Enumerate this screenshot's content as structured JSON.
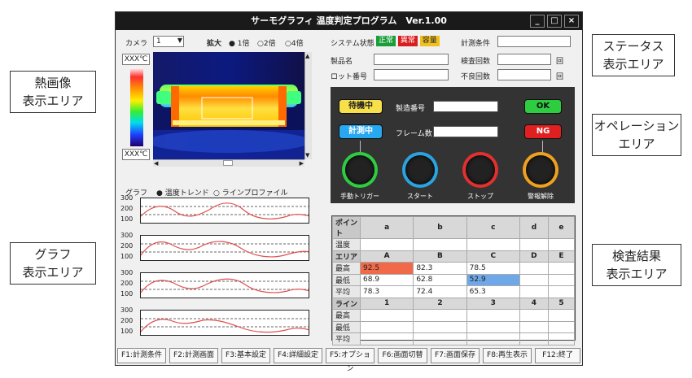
{
  "callouts": {
    "status": "ステータス\n表示エリア",
    "thermal": "熱画像\n表示エリア",
    "operation": "オペレーション\nエリア",
    "graph": "グラフ\n表示エリア",
    "results": "検査結果\n表示エリア"
  },
  "window": {
    "title": "サーモグラフィ 温度判定プログラム　Ver.1.00",
    "minimize": "_",
    "maximize": "□",
    "close": "×"
  },
  "camera": {
    "label": "カメラ",
    "value": "1",
    "zoom_label": "拡大",
    "zoom_options": [
      "1倍",
      "2倍",
      "4倍"
    ],
    "zoom_selected": 0
  },
  "scale": {
    "top": "XXX℃",
    "bottom": "XXX℃"
  },
  "status": {
    "system_label": "システム状態",
    "normal": "正常",
    "abnormal": "異常",
    "capacity": "容量",
    "colors": {
      "normal": "#1a9e3a",
      "abnormal": "#d81e1e",
      "capacity": "#f0c020"
    },
    "product_label": "製品名",
    "lot_label": "ロット番号",
    "condition_label": "計測条件",
    "inspect_count_label": "検査回数",
    "defect_count_label": "不良回数",
    "unit": "回"
  },
  "graph": {
    "label": "グラフ",
    "mode_trend": "温度トレンド",
    "mode_profile": "ラインプロファイル",
    "ticks": [
      "300",
      "200",
      "100"
    ]
  },
  "operation": {
    "standby": "待機中",
    "measuring": "計測中",
    "serial_label": "製造番号",
    "frames_label": "フレーム数",
    "ok": "OK",
    "ng": "NG",
    "knobs": [
      {
        "label": "手動トリガー",
        "color": "#2ecc40"
      },
      {
        "label": "スタート",
        "color": "#2aa3e0"
      },
      {
        "label": "ストップ",
        "color": "#e03030"
      },
      {
        "label": "警報解除",
        "color": "#f0a020"
      }
    ]
  },
  "results": {
    "point_header": "ポイント",
    "points": [
      "a",
      "b",
      "c",
      "d",
      "e"
    ],
    "temp_label": "温度",
    "area_header": "エリア",
    "areas": [
      "A",
      "B",
      "C",
      "D",
      "E"
    ],
    "max_label": "最高",
    "min_label": "最低",
    "avg_label": "平均",
    "max_values": [
      "92.5",
      "82.3",
      "78.5",
      "",
      ""
    ],
    "min_values": [
      "68.9",
      "62.8",
      "52.9",
      "",
      ""
    ],
    "avg_values": [
      "78.3",
      "72.4",
      "65.3",
      "",
      ""
    ],
    "highlight_max_color": "#f06a4a",
    "highlight_min_color": "#6fa8e8",
    "line_header": "ライン",
    "lines": [
      "1",
      "2",
      "3",
      "4",
      "5"
    ]
  },
  "fkeys": [
    "F1:計測条件",
    "F2:計測画面",
    "F3:基本設定",
    "F4:詳細設定",
    "F5:オプション",
    "F6:画面切替",
    "F7:画面保存",
    "F8:再生表示",
    "F12:終了"
  ]
}
